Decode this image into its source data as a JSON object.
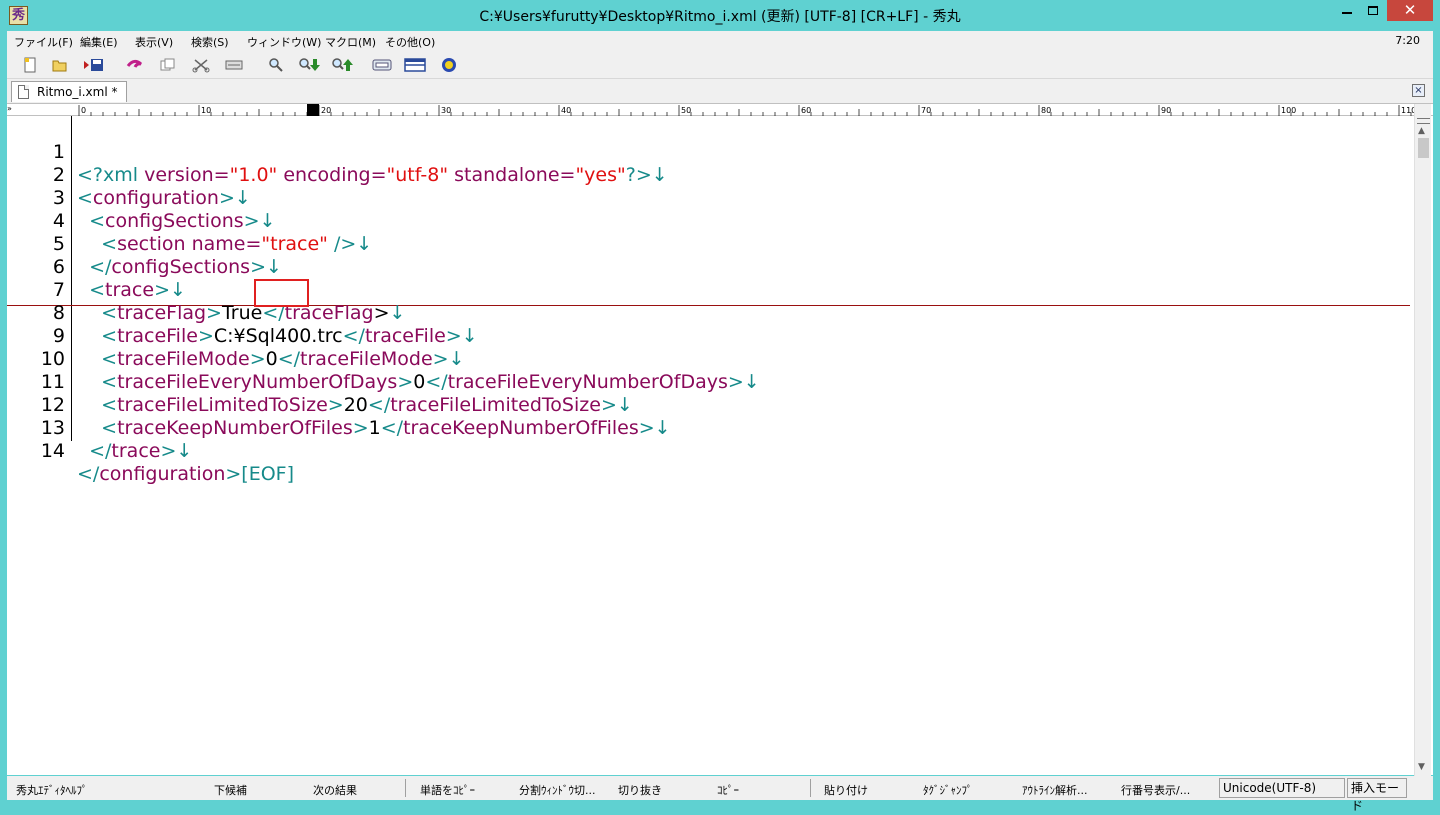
{
  "window": {
    "title": "C:¥Users¥furutty¥Desktop¥Ritmo_i.xml (更新) [UTF-8] [CR+LF] - 秀丸",
    "app_icon_glyph": "秀",
    "minimize": "—",
    "maximize": "□",
    "close": "✕"
  },
  "menu": {
    "items": [
      "ファイル(F)",
      "編集(E)",
      "表示(V)",
      "検索(S)",
      "ウィンドウ(W)",
      "マクロ(M)",
      "その他(O)"
    ],
    "clock": "7:20"
  },
  "toolbar": {
    "icons": [
      "new-file-icon",
      "open-folder-icon",
      "save-icon",
      "undo-icon",
      "copy-icon",
      "cut-icon",
      "paste-icon",
      "find-icon",
      "find-next-icon",
      "find-prev-icon",
      "keyboard-icon",
      "split-window-icon",
      "help-icon"
    ]
  },
  "tab": {
    "label": "Ritmo_i.xml *",
    "close": "×"
  },
  "ruler": {
    "marker": "»",
    "labels": [
      "0",
      "10",
      "20",
      "30",
      "40",
      "50",
      "60",
      "70",
      "80",
      "90",
      "100",
      "110"
    ]
  },
  "editor": {
    "line_numbers": [
      "1",
      "2",
      "3",
      "4",
      "5",
      "6",
      "7",
      "8",
      "9",
      "10",
      "11",
      "12",
      "13",
      "14"
    ],
    "newline_mark": "↓",
    "eof_mark": "[EOF]",
    "lines": {
      "l1": {
        "open": "<?xml ",
        "a1": "version=",
        "v1": "\"1.0\"",
        "a2": " encoding=",
        "v2": "\"utf-8\"",
        "a3": " standalone=",
        "v3": "\"yes\"",
        "close": "?>"
      },
      "l2": {
        "open": "<",
        "name": "configuration",
        "close": ">"
      },
      "l3": {
        "indent": "  ",
        "open": "<",
        "name": "configSections",
        "close": ">"
      },
      "l4": {
        "indent": "    ",
        "open": "<",
        "name": "section ",
        "attr": "name=",
        "val": "\"trace\"",
        "close": " />"
      },
      "l5": {
        "indent": "  ",
        "open": "</",
        "name": "configSections",
        "close": ">"
      },
      "l6": {
        "indent": "  ",
        "open": "<",
        "name": "trace",
        "close": ">"
      },
      "l7": {
        "indent": "    ",
        "open": "<",
        "name": "traceFlag",
        "close": ">",
        "value": "True",
        "end_open": "</",
        "end_name": "traceFlag",
        "end_close": ">"
      },
      "l8": {
        "indent": "    ",
        "open": "<",
        "name": "traceFile",
        "close": ">",
        "value": "C:¥Sql400.trc",
        "end_open": "</",
        "end_name": "traceFile",
        "end_close": ">"
      },
      "l9": {
        "indent": "    ",
        "open": "<",
        "name": "traceFileMode",
        "close": ">",
        "value": "0",
        "end_open": "</",
        "end_name": "traceFileMode",
        "end_close": ">"
      },
      "l10": {
        "indent": "    ",
        "open": "<",
        "name": "traceFileEveryNumberOfDays",
        "close": ">",
        "value": "0",
        "end_open": "</",
        "end_name": "traceFileEveryNumberOfDays",
        "end_close": ">"
      },
      "l11": {
        "indent": "    ",
        "open": "<",
        "name": "traceFileLimitedToSize",
        "close": ">",
        "value": "20",
        "end_open": "</",
        "end_name": "traceFileLimitedToSize",
        "end_close": ">"
      },
      "l12": {
        "indent": "    ",
        "open": "<",
        "name": "traceKeepNumberOfFiles",
        "close": ">",
        "value": "1",
        "end_open": "</",
        "end_name": "traceKeepNumberOfFiles",
        "end_close": ">"
      },
      "l13": {
        "indent": "  ",
        "open": "</",
        "name": "trace",
        "close": ">"
      },
      "l14": {
        "open": "</",
        "name": "configuration",
        "close": ">"
      }
    }
  },
  "scrollbar": {
    "up": "▲",
    "down": "▼"
  },
  "statusbar": {
    "function_keys": [
      "秀丸ｴﾃﾞｨﾀﾍﾙﾌﾟ",
      "下候補",
      "次の結果",
      "単語をｺﾋﾟｰ",
      "分割ｳｨﾝﾄﾞｳ切...",
      "切り抜き",
      "ｺﾋﾟｰ",
      "貼り付け",
      "ﾀｸﾞｼﾞｬﾝﾌﾟ",
      "ｱｳﾄﾗｲﾝ解析...",
      "行番号表示/..."
    ],
    "encoding": "Unicode(UTF-8)",
    "mode": "挿入モード"
  },
  "colors": {
    "window_frame": "#5fd1d1",
    "tag": "#8a0a5a",
    "bracket": "#168a8a",
    "string": "#e01010",
    "cursor_line": "#9a1010",
    "cursor_box": "#e02020",
    "close_button": "#c7473d"
  }
}
